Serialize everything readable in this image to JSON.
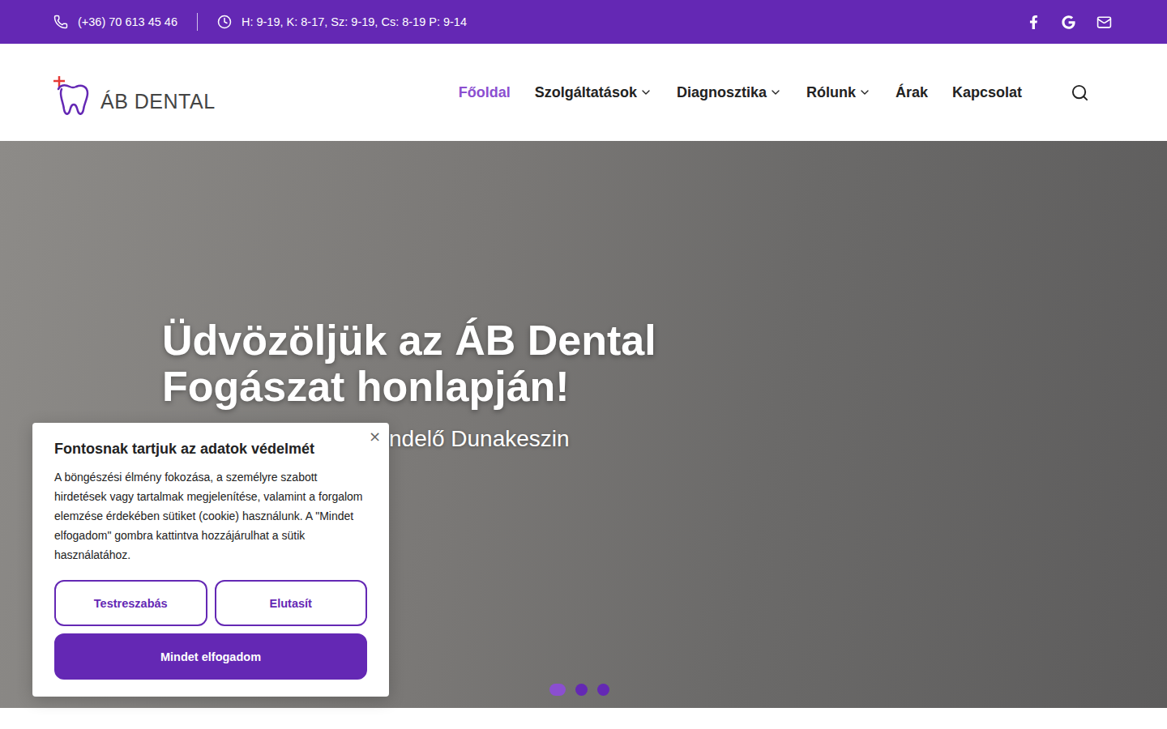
{
  "topbar": {
    "phone": "(+36) 70 613 45 46",
    "hours": "H: 9-19, K: 8-17, Sz: 9-19, Cs: 8-19 P: 9-14"
  },
  "logo": {
    "text": "ÁB DENTAL"
  },
  "nav": [
    {
      "label": "Főoldal",
      "selected": true,
      "dropdown": false
    },
    {
      "label": "Szolgáltatások",
      "selected": false,
      "dropdown": true
    },
    {
      "label": "Diagnosztika",
      "selected": false,
      "dropdown": true
    },
    {
      "label": "Rólunk",
      "selected": false,
      "dropdown": true
    },
    {
      "label": "Árak",
      "selected": false,
      "dropdown": false
    },
    {
      "label": "Kapcsolat",
      "selected": false,
      "dropdown": false
    }
  ],
  "hero": {
    "title_lines": [
      "Üdvözöljük az ÁB Dental",
      "Fogászat honlapján!"
    ],
    "subtitle": "ndelő Dunakeszin",
    "slides": [
      {
        "selected": true
      },
      {
        "selected": false
      },
      {
        "selected": false
      }
    ]
  },
  "cookie": {
    "title": "Fontosnak tartjuk az adatok védelmét",
    "text": "A böngészési élmény fokozása, a személyre szabott hirdetések vagy tartalmak megjelenítése, valamint a forgalom elemzése érdekében sütiket (cookie) használunk. A \"Mindet elfogadom\" gombra kattintva hozzájárulhat a sütik használatához.",
    "close": "×",
    "buttons": [
      {
        "label": "Testreszabás",
        "kind": "outline"
      },
      {
        "label": "Elutasít",
        "kind": "outline"
      },
      {
        "label": "Mindet elfogadom",
        "kind": "filled"
      }
    ]
  }
}
